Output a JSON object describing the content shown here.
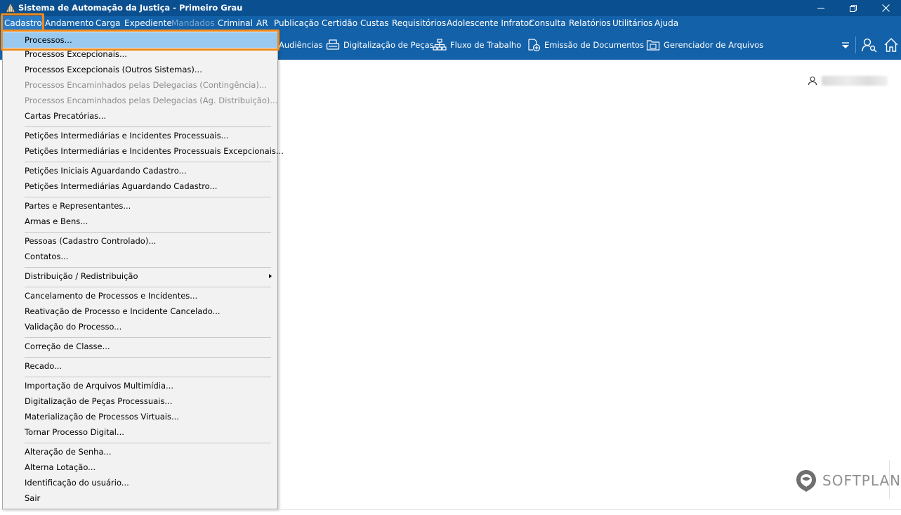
{
  "window": {
    "title": "Sistema de Automação da Justiça - Primeiro Grau"
  },
  "menubar": {
    "items": [
      {
        "label": "Cadastro"
      },
      {
        "label": "Andamento"
      },
      {
        "label": "Carga"
      },
      {
        "label": "Expediente"
      },
      {
        "label": "Mandados"
      },
      {
        "label": "Criminal"
      },
      {
        "label": "AR"
      },
      {
        "label": "Publicação"
      },
      {
        "label": "Certidão"
      },
      {
        "label": "Custas"
      },
      {
        "label": "Requisitórios"
      },
      {
        "label": "Adolescente Infrator"
      },
      {
        "label": "Consulta"
      },
      {
        "label": "Relatórios"
      },
      {
        "label": "Utilitários"
      },
      {
        "label": "Ajuda"
      }
    ]
  },
  "toolbar": {
    "items": [
      {
        "label": "Audiências",
        "icon": "calendar-icon"
      },
      {
        "label": "Digitalização de Peças",
        "icon": "scanner-icon"
      },
      {
        "label": "Fluxo de Trabalho",
        "icon": "workflow-icon"
      },
      {
        "label": "Emissão de Documentos",
        "icon": "document-add-icon"
      },
      {
        "label": "Gerenciador de Arquivos",
        "icon": "folder-icon"
      }
    ]
  },
  "dropdown": {
    "items": [
      {
        "label": "Processos..."
      },
      {
        "label": "Processos Excepcionais..."
      },
      {
        "label": "Processos Excepcionais (Outros Sistemas)..."
      },
      {
        "label": "Processos Encaminhados pelas Delegacias (Contingência)..."
      },
      {
        "label": "Processos Encaminhados pelas Delegacias (Ag. Distribuição)..."
      },
      {
        "label": "Cartas Precatórias..."
      },
      {
        "label": "Petições Intermediárias e Incidentes Processuais..."
      },
      {
        "label": "Petições Intermediárias e Incidentes Processuais Excepcionais..."
      },
      {
        "label": "Petições Iniciais Aguardando Cadastro..."
      },
      {
        "label": "Petições Intermediárias Aguardando Cadastro..."
      },
      {
        "label": "Partes e Representantes..."
      },
      {
        "label": "Armas e Bens..."
      },
      {
        "label": "Pessoas (Cadastro Controlado)..."
      },
      {
        "label": "Contatos..."
      },
      {
        "label": "Distribuição / Redistribuição"
      },
      {
        "label": "Cancelamento de Processos e Incidentes..."
      },
      {
        "label": "Reativação de Processo e Incidente Cancelado..."
      },
      {
        "label": "Validação do Processo..."
      },
      {
        "label": "Correção de Classe..."
      },
      {
        "label": "Recado..."
      },
      {
        "label": "Importação de Arquivos Multimídia..."
      },
      {
        "label": "Digitalização de Peças Processuais..."
      },
      {
        "label": "Materialização de Processos Virtuais..."
      },
      {
        "label": "Tornar Processo Digital..."
      },
      {
        "label": "Alteração de Senha..."
      },
      {
        "label": "Alterna Lotação..."
      },
      {
        "label": "Identificação do usuário..."
      },
      {
        "label": "Sair"
      }
    ]
  },
  "brand": {
    "name": "SOFTPLAN"
  },
  "colors": {
    "titlebar": "#0a4f8f",
    "menubar": "#1361a8",
    "highlight": "#ef8a1e",
    "selected": "#99c9ef"
  }
}
